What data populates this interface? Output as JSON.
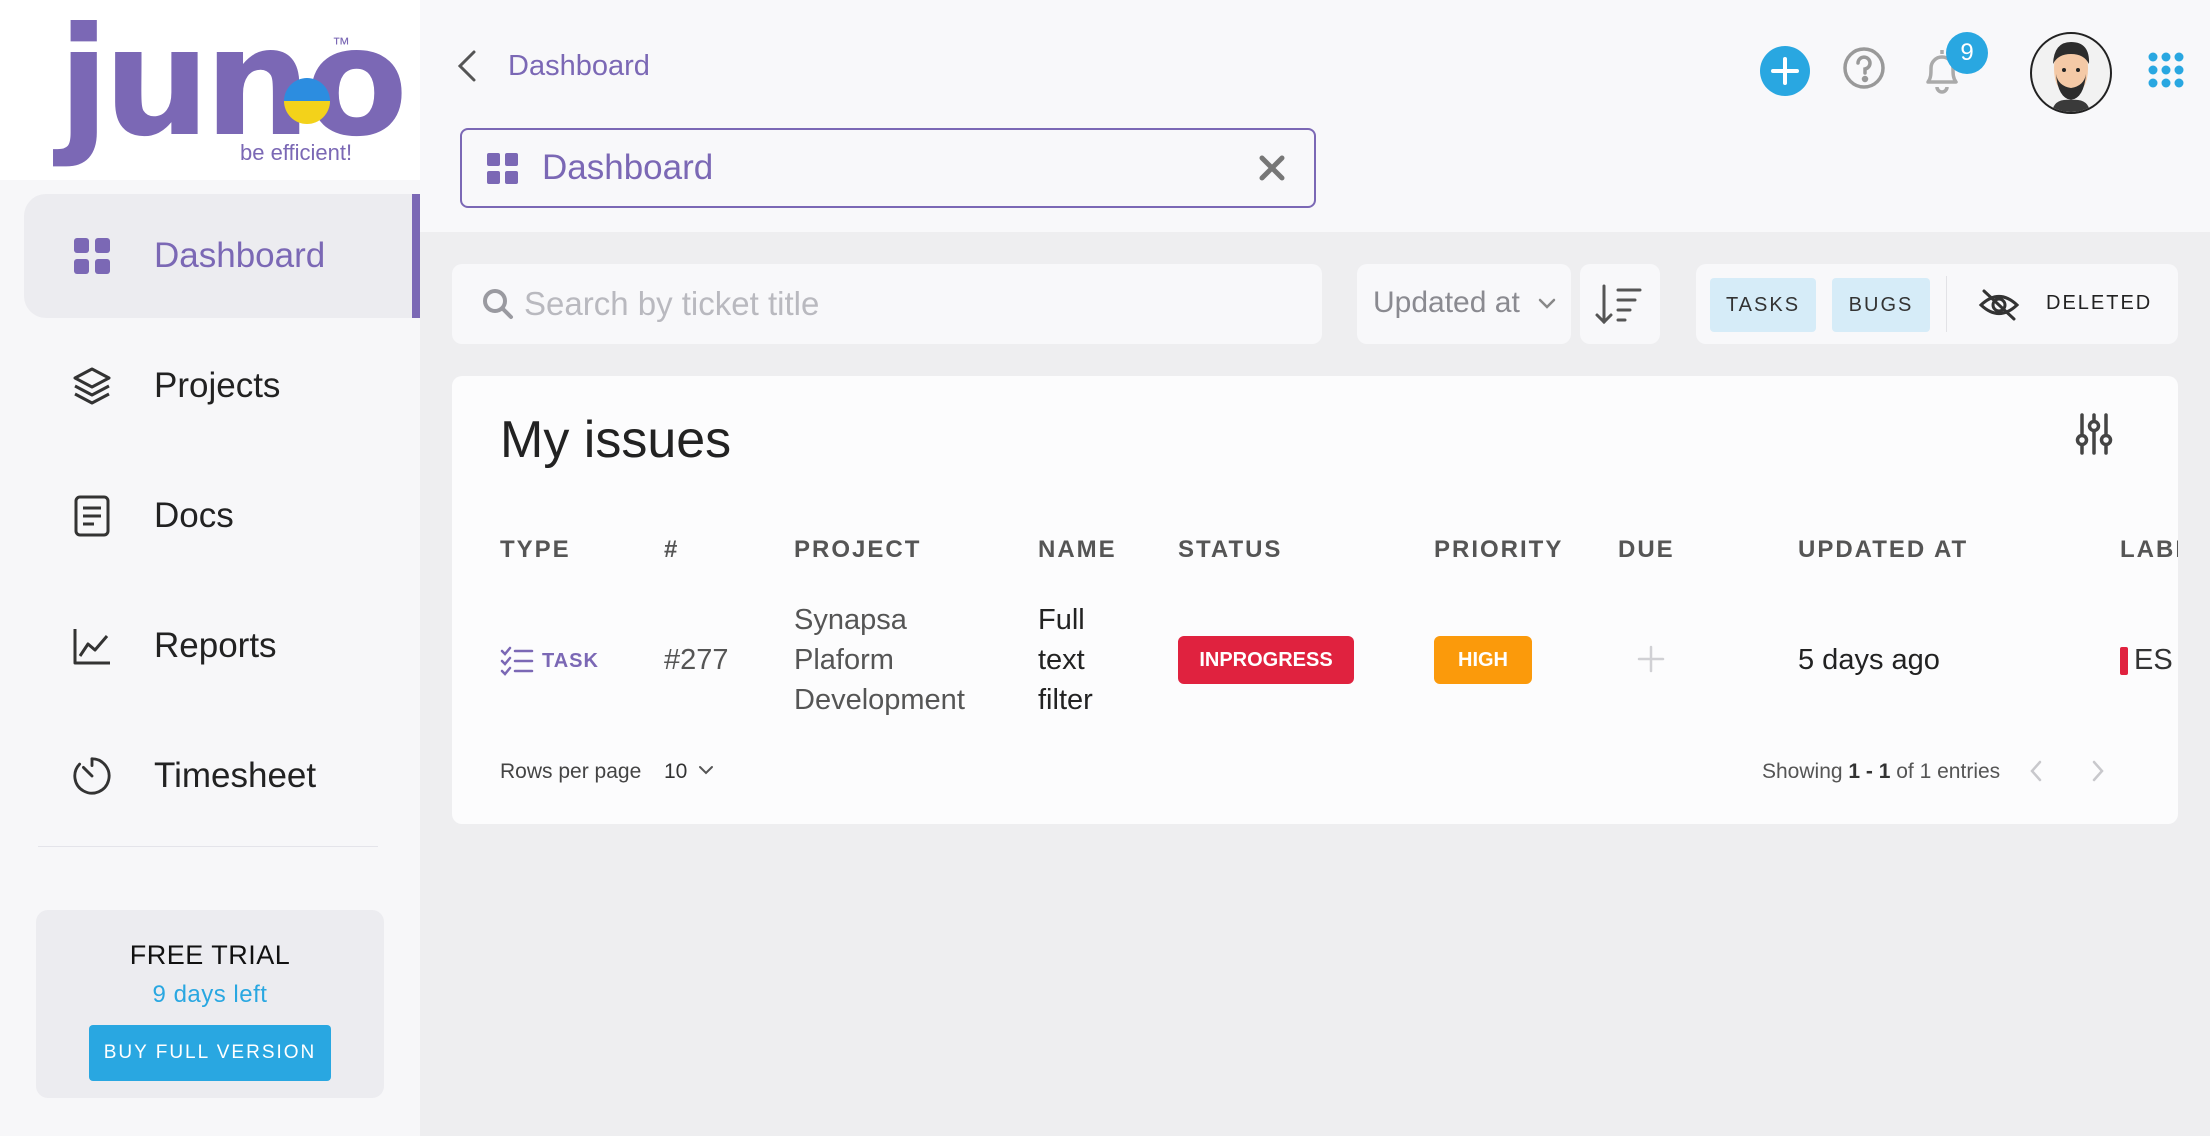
{
  "brand": {
    "logo_text": "juno",
    "trademark": "™",
    "tagline": "be efficient!"
  },
  "sidebar": {
    "items": [
      {
        "label": "Dashboard",
        "icon": "grid-icon",
        "active": true
      },
      {
        "label": "Projects",
        "icon": "layers-icon",
        "active": false
      },
      {
        "label": "Docs",
        "icon": "document-icon",
        "active": false
      },
      {
        "label": "Reports",
        "icon": "line-chart-icon",
        "active": false
      },
      {
        "label": "Timesheet",
        "icon": "timer-icon",
        "active": false
      }
    ],
    "trial": {
      "title": "FREE TRIAL",
      "days_left": "9 days left",
      "button_label": "BUY FULL VERSION"
    }
  },
  "header": {
    "breadcrumb": "Dashboard",
    "open_tab": "Dashboard",
    "notification_count": "9"
  },
  "filters": {
    "search_placeholder": "Search by ticket title",
    "sort_by": "Updated at",
    "chips": {
      "tasks": "TASKS",
      "bugs": "BUGS"
    },
    "deleted_label": "DELETED"
  },
  "issues": {
    "title": "My issues",
    "columns": {
      "type": "TYPE",
      "num": "#",
      "project": "PROJECT",
      "name": "NAME",
      "status": "STATUS",
      "priority": "PRIORITY",
      "due": "DUE",
      "updated": "UPDATED AT",
      "label": "LABELS"
    },
    "rows": [
      {
        "type": "TASK",
        "num": "#277",
        "project": "Synapsa Plaform Development",
        "name": "Full text filter",
        "status": "INPROGRESS",
        "priority": "HIGH",
        "due": "",
        "updated": "5 days ago",
        "label": "ES"
      }
    ],
    "footer": {
      "rows_per_page_label": "Rows per page",
      "rows_per_page": "10",
      "showing_prefix": "Showing ",
      "range": "1 - 1",
      "of_text": " of ",
      "total": "1",
      "entries_text": " entries"
    }
  },
  "colors": {
    "brand_purple": "#7b68b5",
    "accent_blue": "#29a7e1",
    "status_red": "#e0223f",
    "priority_orange": "#fb9a0b"
  }
}
